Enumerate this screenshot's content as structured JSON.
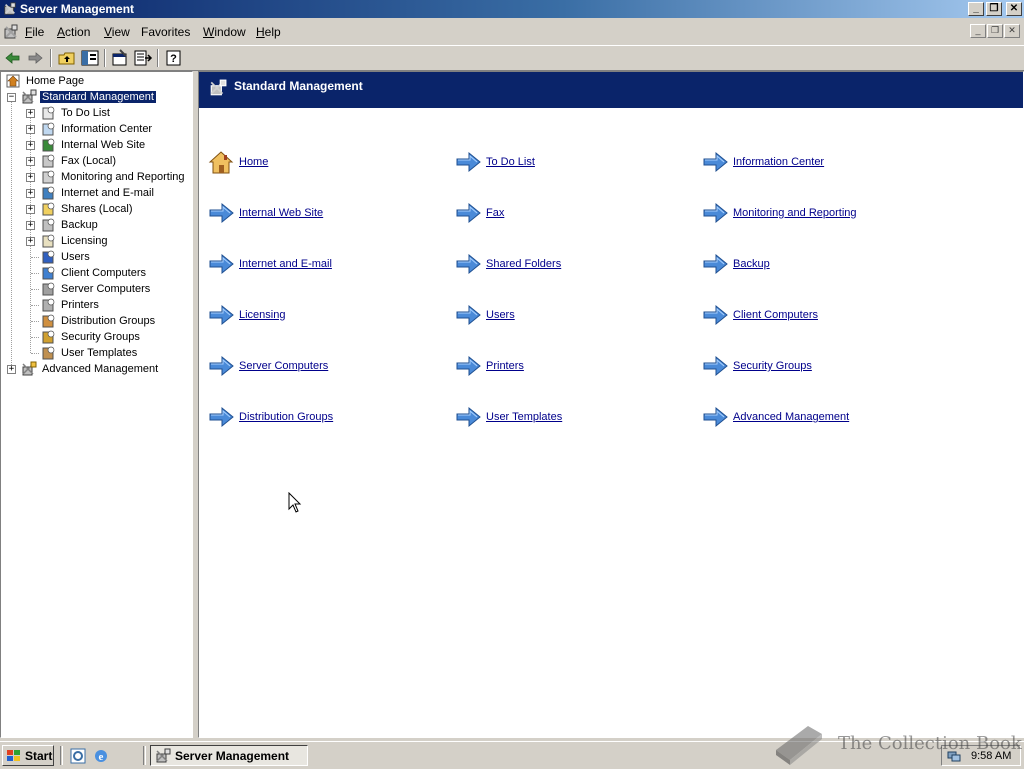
{
  "window": {
    "title": "Server Management"
  },
  "caption_buttons": {
    "minimize": "_",
    "restore": "❐",
    "close": "✕"
  },
  "menu": [
    {
      "label": "File",
      "accel": "F",
      "rest": "ile"
    },
    {
      "label": "Action",
      "accel": "A",
      "rest": "ction"
    },
    {
      "label": "View",
      "accel": "V",
      "rest": "iew"
    },
    {
      "label": "Favorites",
      "accel": "",
      "rest": "Favorites"
    },
    {
      "label": "Window",
      "accel": "W",
      "rest": "indow"
    },
    {
      "label": "Help",
      "accel": "H",
      "rest": "elp"
    }
  ],
  "toolbar": {
    "icons": [
      "back-arrow-icon",
      "forward-arrow-icon",
      "up-one-level-icon",
      "show-hide-tree-icon",
      "properties-icon",
      "export-list-icon",
      "help-icon"
    ]
  },
  "tree": {
    "home": "Home Page",
    "standard": "Standard Management",
    "children": [
      "To Do List",
      "Information Center",
      "Internal Web Site",
      "Fax (Local)",
      "Monitoring and Reporting",
      "Internet and E-mail",
      "Shares (Local)",
      "Backup",
      "Licensing",
      "Users",
      "Client Computers",
      "Server Computers",
      "Printers",
      "Distribution Groups",
      "Security Groups",
      "User Templates"
    ],
    "advanced": "Advanced Management"
  },
  "content": {
    "banner_title": "Standard Management",
    "links": [
      [
        "Home",
        "To Do List",
        "Information Center"
      ],
      [
        "Internal Web Site",
        "Fax",
        "Monitoring and Reporting"
      ],
      [
        "Internet and E-mail",
        "Shared Folders",
        "Backup"
      ],
      [
        "Licensing",
        "Users",
        "Client Computers"
      ],
      [
        "Server Computers",
        "Printers",
        "Security Groups"
      ],
      [
        "Distribution Groups",
        "User Templates",
        "Advanced Management"
      ]
    ]
  },
  "taskbar": {
    "start_label": "Start",
    "task_label": "Server Management",
    "clock": "9:58 AM"
  },
  "watermark": {
    "text": "The Collection Book"
  },
  "colors": {
    "title_active": "#0a246a",
    "banner": "#0a246a",
    "link": "#00008b",
    "face": "#d4d0c8"
  }
}
